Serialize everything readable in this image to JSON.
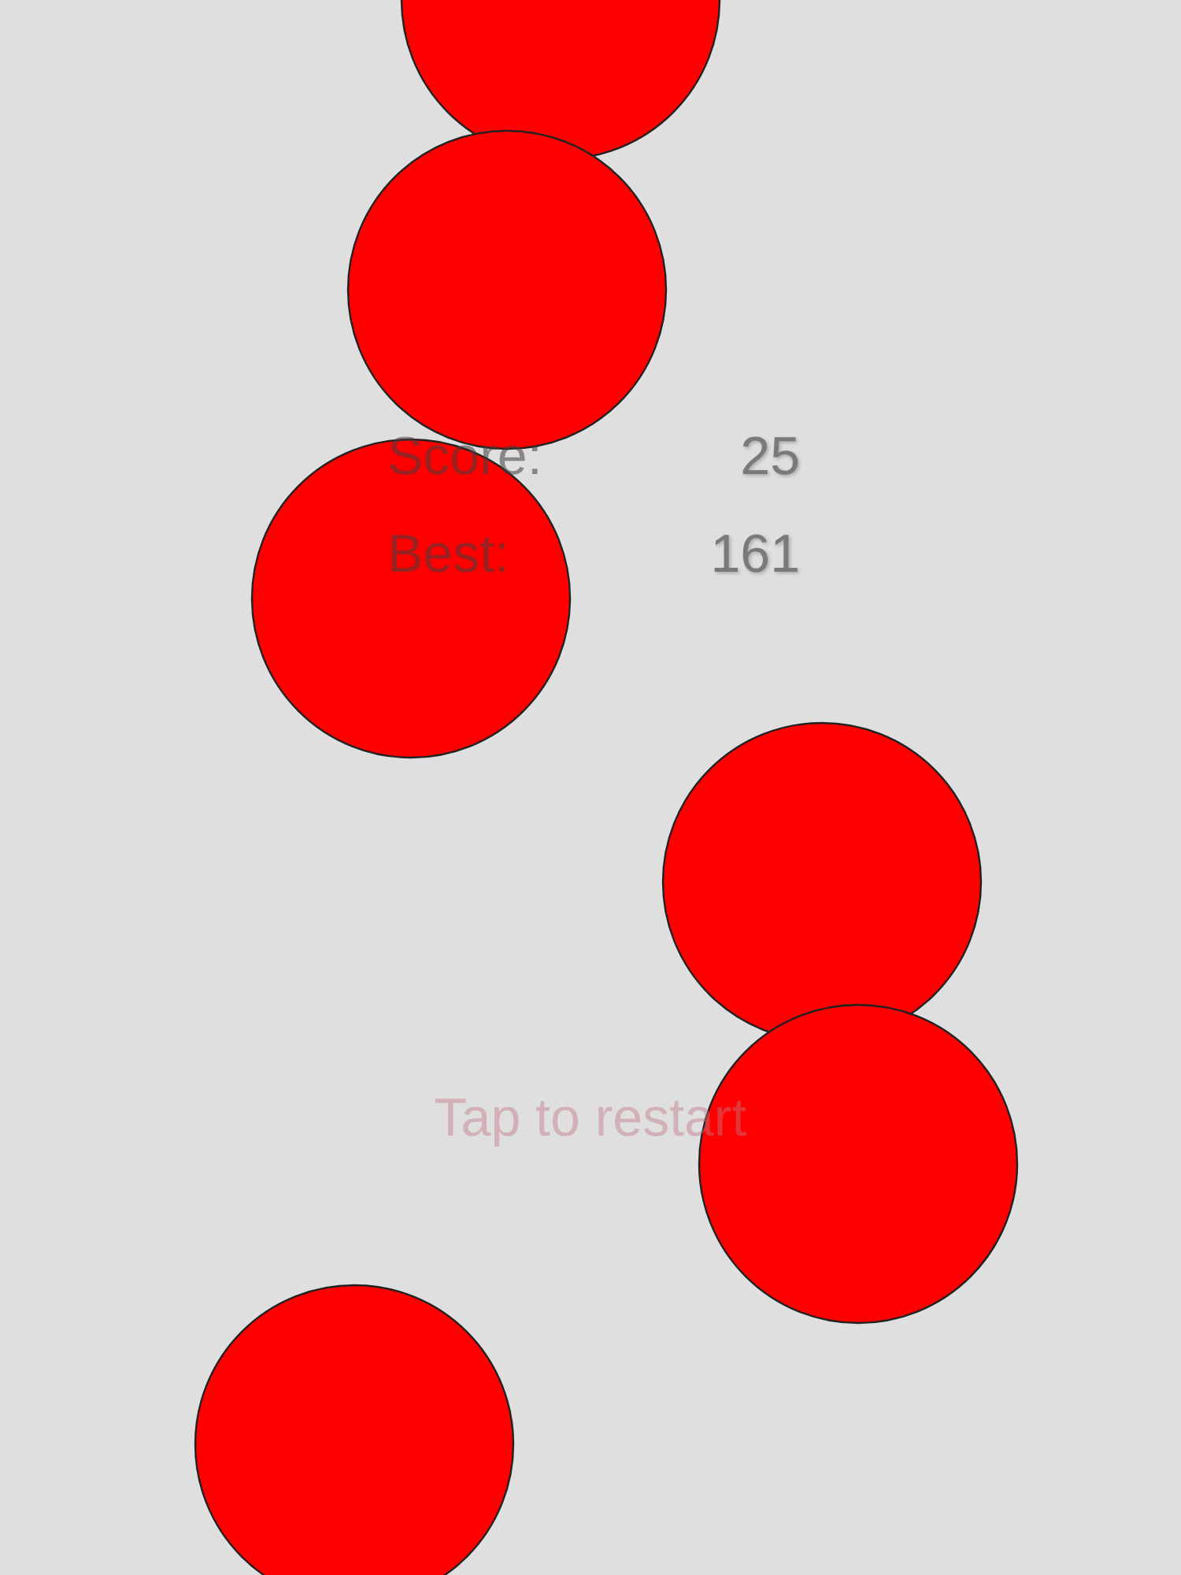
{
  "scores": [
    {
      "label": "Score:",
      "value": "25"
    },
    {
      "label": "Best:",
      "value": "161"
    }
  ],
  "prompt": "Tap to restart"
}
